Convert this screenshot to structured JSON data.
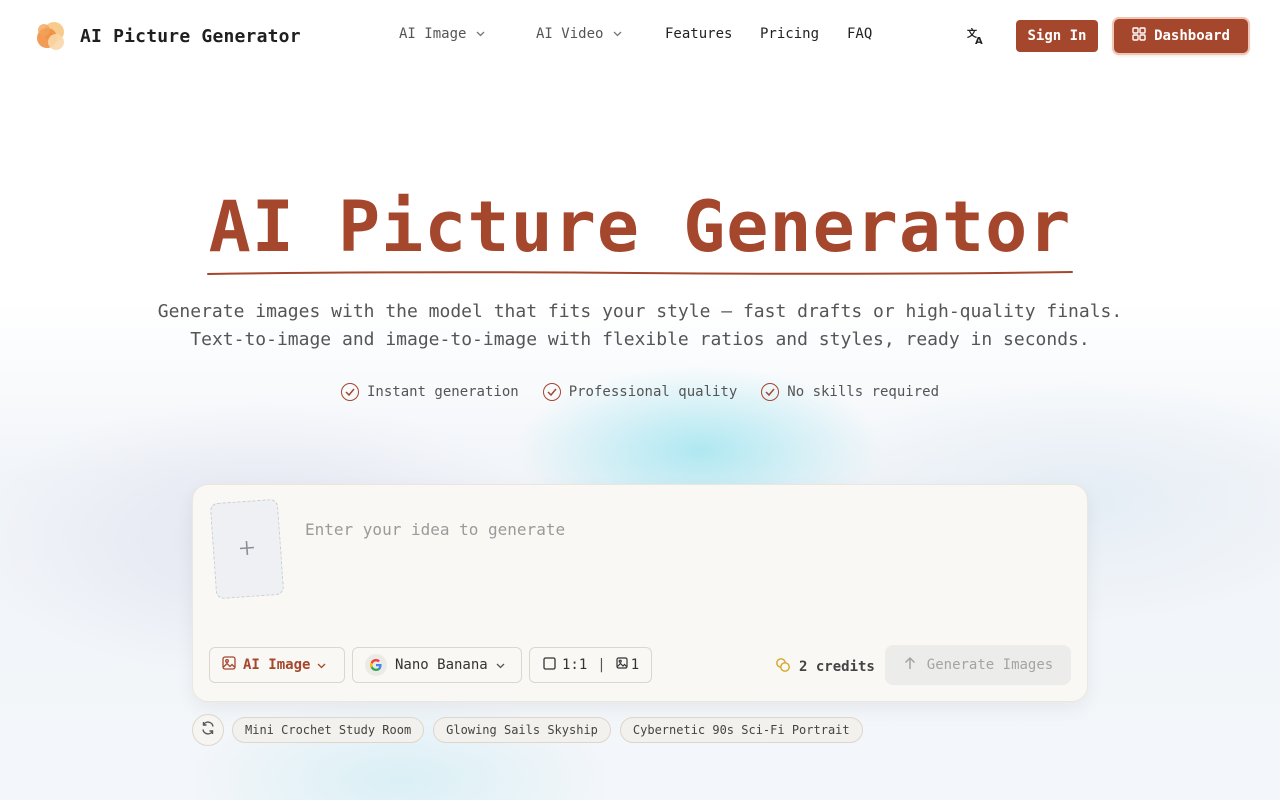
{
  "header": {
    "logo_text": "AI Picture Generator",
    "nav": [
      {
        "label": "AI Image",
        "has_dropdown": true
      },
      {
        "label": "AI Video",
        "has_dropdown": true
      },
      {
        "label": "Features",
        "has_dropdown": false
      },
      {
        "label": "Pricing",
        "has_dropdown": false
      },
      {
        "label": "FAQ",
        "has_dropdown": false
      }
    ],
    "language_icon": "translate-icon",
    "signin_label": "Sign In",
    "dashboard_label": "Dashboard"
  },
  "hero": {
    "title": "AI Picture Generator",
    "subtitle_line1": "Generate images with the model that fits your style — fast drafts or high-quality finals.",
    "subtitle_line2": "Text-to-image and image-to-image with flexible ratios and styles, ready in seconds.",
    "features": [
      "Instant generation",
      "Professional quality",
      "No skills required"
    ]
  },
  "generator": {
    "prompt_placeholder": "Enter your idea to generate",
    "prompt_value": "",
    "mode_label": "AI Image",
    "model_label": "Nano Banana",
    "ratio_label": "1:1",
    "ratio_separator": "|",
    "count_label": "1",
    "credits_label": "2 credits",
    "generate_label": "Generate Images"
  },
  "suggestions": [
    "Mini Crochet Study Room",
    "Glowing Sails Skyship",
    "Cybernetic 90s Sci-Fi Portrait"
  ],
  "colors": {
    "accent": "#a5472d",
    "accent_border": "#f1c4b4",
    "card_bg": "#faf8f5",
    "disabled_button": "#ececea"
  }
}
